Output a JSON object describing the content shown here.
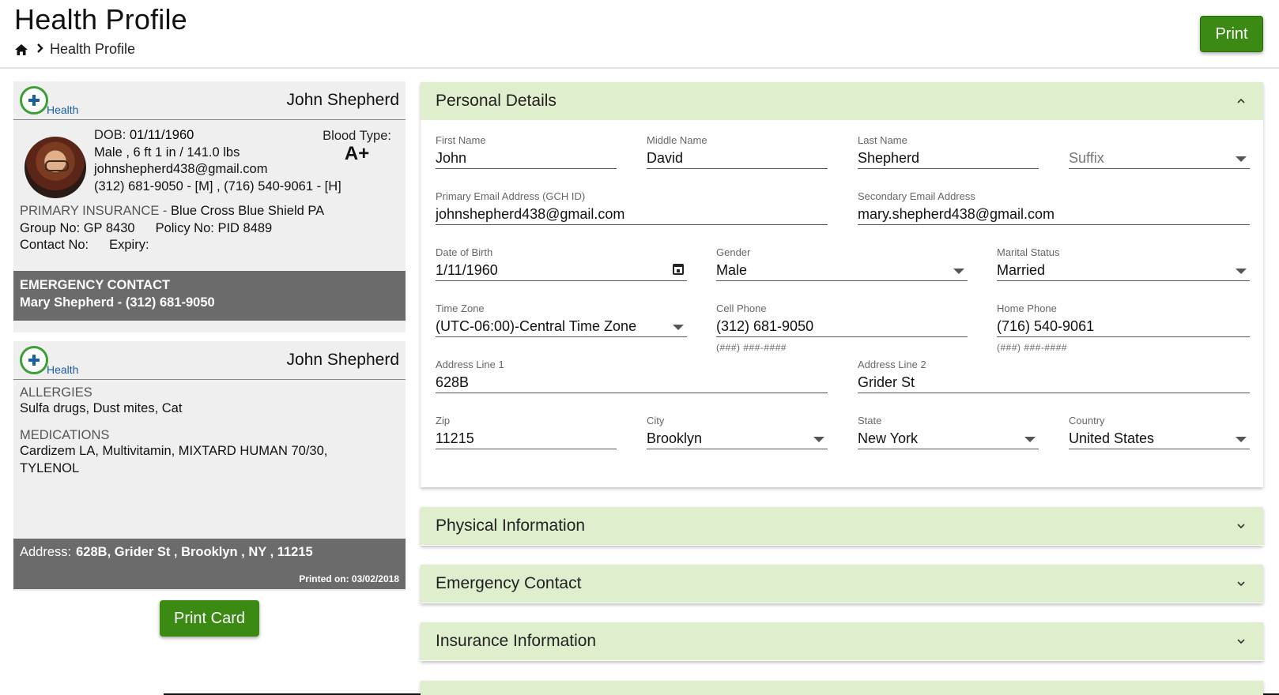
{
  "header": {
    "title": "Health Profile",
    "breadcrumb_current": "Health Profile",
    "print_label": "Print"
  },
  "card1": {
    "logo_text": "Health",
    "name": "John Shepherd",
    "dob_label": "DOB:",
    "dob": "01/11/1960",
    "physical": "Male , 6 ft 1 in / 141.0 lbs",
    "email": "johnshepherd438@gmail.com",
    "phones": "(312) 681-9050 - [M] , (716) 540-9061 - [H]",
    "blood_label": "Blood Type:",
    "blood_value": "A+",
    "insurance_label": "PRIMARY INSURANCE -",
    "insurance_value": "Blue Cross Blue Shield PA",
    "group_label": "Group No:",
    "group_value": "GP 8430",
    "policy_label": "Policy No:",
    "policy_value": "PID 8489",
    "contact_label": "Contact No:",
    "expiry_label": "Expiry:",
    "emergency_title": "EMERGENCY CONTACT",
    "emergency_value": "Mary Shepherd - (312) 681-9050"
  },
  "card2": {
    "logo_text": "Health",
    "name": "John Shepherd",
    "allergies_label": "ALLERGIES",
    "allergies_value": "Sulfa drugs,  Dust mites,  Cat",
    "medications_label": "MEDICATIONS",
    "medications_value": "Cardizem LA,  Multivitamin,  MIXTARD HUMAN 70/30,  TYLENOL",
    "address_label": "Address:",
    "address_value": "628B, Grider St , Brooklyn , NY , 11215",
    "printed_on": "Printed on: 03/02/2018",
    "print_card_label": "Print Card"
  },
  "personal": {
    "title": "Personal Details",
    "first_name": {
      "label": "First Name",
      "value": "John"
    },
    "middle_name": {
      "label": "Middle Name",
      "value": "David"
    },
    "last_name": {
      "label": "Last Name",
      "value": "Shepherd"
    },
    "suffix": {
      "placeholder": "Suffix"
    },
    "primary_email": {
      "label": "Primary Email Address (GCH ID)",
      "value": "johnshepherd438@gmail.com"
    },
    "secondary_email": {
      "label": "Secondary Email Address",
      "value": "mary.shepherd438@gmail.com"
    },
    "dob": {
      "label": "Date of Birth",
      "value": "1/11/1960"
    },
    "gender": {
      "label": "Gender",
      "value": "Male"
    },
    "marital": {
      "label": "Marital Status",
      "value": "Married"
    },
    "timezone": {
      "label": "Time Zone",
      "value": "(UTC-06:00)-Central Time Zone"
    },
    "cell": {
      "label": "Cell Phone",
      "value": "(312) 681-9050",
      "hint": "(###) ###-####"
    },
    "home": {
      "label": "Home Phone",
      "value": "(716) 540-9061",
      "hint": "(###) ###-####"
    },
    "address1": {
      "label": "Address Line 1",
      "value": "628B"
    },
    "address2": {
      "label": "Address Line 2",
      "value": "Grider St"
    },
    "zip": {
      "label": "Zip",
      "value": "11215"
    },
    "city": {
      "label": "City",
      "value": "Brooklyn"
    },
    "state": {
      "label": "State",
      "value": "New York"
    },
    "country": {
      "label": "Country",
      "value": "United States"
    }
  },
  "sections": {
    "physical": "Physical Information",
    "emergency": "Emergency Contact",
    "insurance": "Insurance Information"
  },
  "colors": {
    "accent_green": "#3a8a14",
    "panel_header": "#dfeecd",
    "card_bg": "#efefef",
    "dark_bar": "#6b6b6b"
  },
  "icons": [
    "home-icon",
    "chevron-right-icon",
    "chevron-up-icon",
    "chevron-down-icon",
    "calendar-icon",
    "dropdown-caret-icon",
    "health-logo-icon"
  ]
}
